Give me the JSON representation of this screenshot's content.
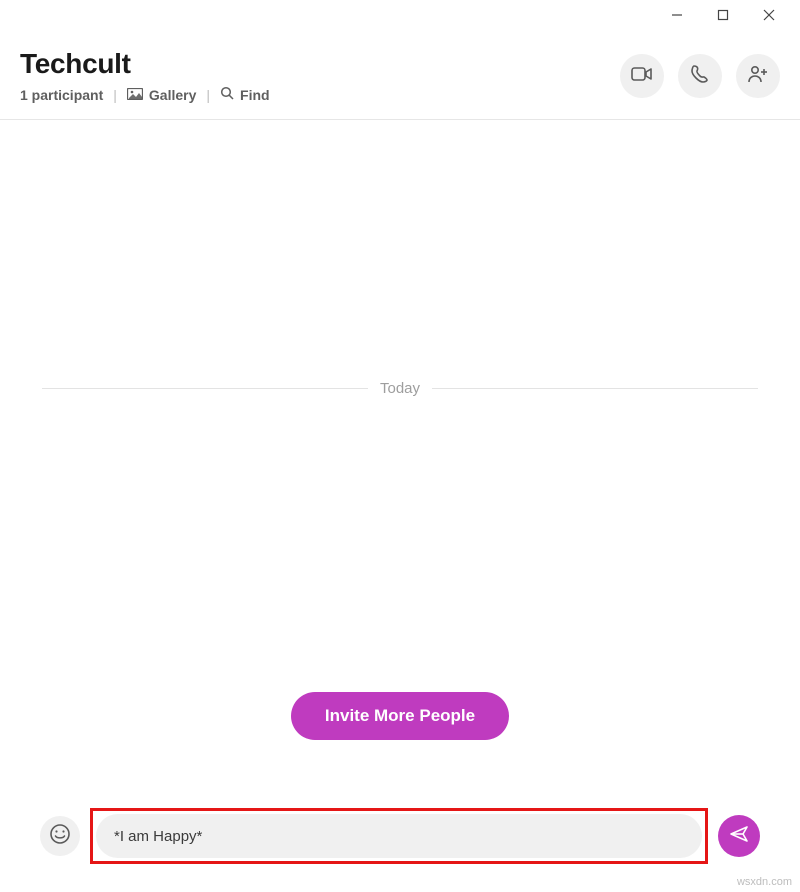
{
  "header": {
    "title": "Techcult",
    "participants_label": "1 participant",
    "gallery_label": "Gallery",
    "find_label": "Find"
  },
  "divider": {
    "label": "Today"
  },
  "invite": {
    "label": "Invite More People"
  },
  "composer": {
    "value": "*I am Happy*"
  },
  "watermark": "wsxdn.com"
}
